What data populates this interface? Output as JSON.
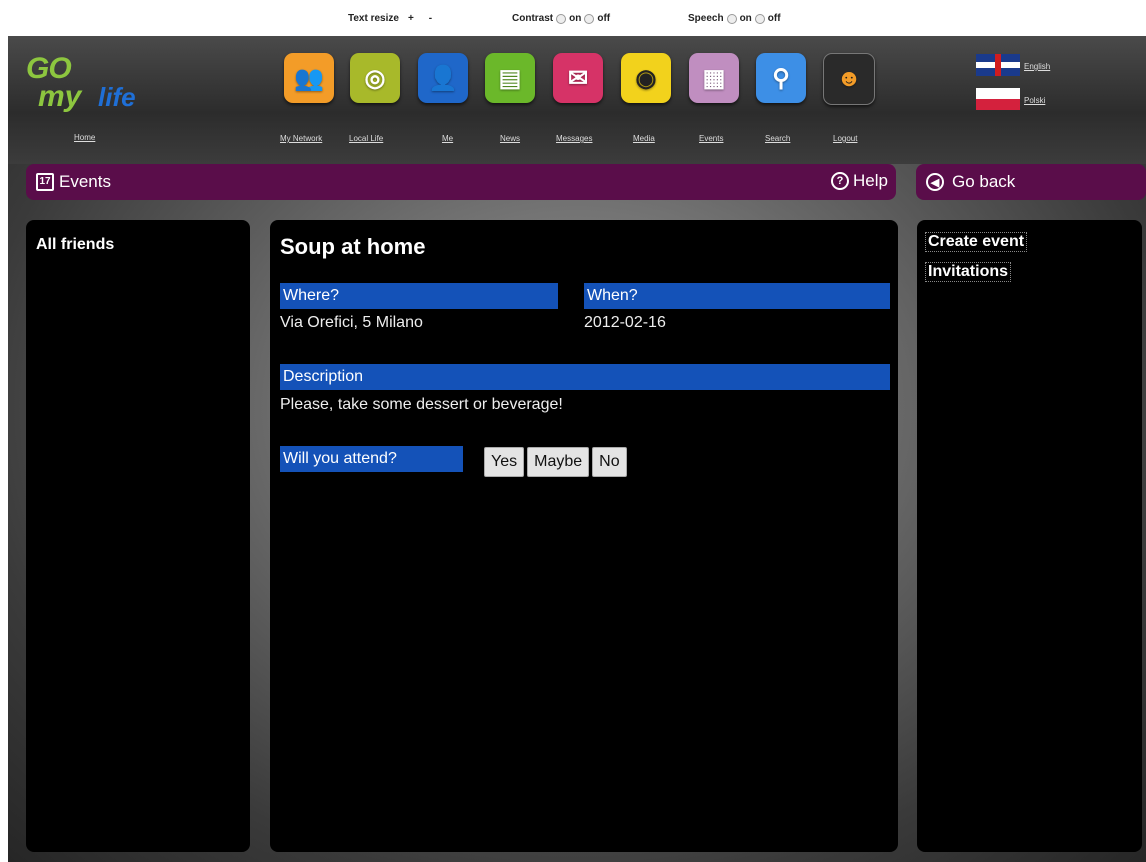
{
  "accessibility": {
    "text_resize_label": "Text resize",
    "text_increase": "+",
    "text_decrease": "-",
    "contrast_label": "Contrast",
    "speech_label": "Speech",
    "on": "on",
    "off": "off"
  },
  "header": {
    "logo_go": "GO",
    "logo_my": "my",
    "logo_life": "life",
    "home_label": "Home",
    "nav": [
      {
        "label": "My Network",
        "icon": "people-icon",
        "color": "#f39c28"
      },
      {
        "label": "Local Life",
        "icon": "target-icon",
        "color": "#a8b92a"
      },
      {
        "label": "Me",
        "icon": "person-icon",
        "color": "#1f67c9"
      },
      {
        "label": "News",
        "icon": "document-icon",
        "color": "#6bb82a"
      },
      {
        "label": "Messages",
        "icon": "envelope-icon",
        "color": "#d63367"
      },
      {
        "label": "Media",
        "icon": "camera-icon",
        "color": "#f2d21c"
      },
      {
        "label": "Events",
        "icon": "calendar-icon",
        "color": "#c08ec0"
      },
      {
        "label": "Search",
        "icon": "magnifier-icon",
        "color": "#3d8fe6"
      },
      {
        "label": "Logout",
        "icon": "user-logout-icon",
        "color": "#2a2a2a"
      }
    ],
    "languages": [
      "English",
      "Polski"
    ]
  },
  "events_bar": {
    "title": "Events",
    "calendar_num": "17",
    "help_label": "Help",
    "help_icon": "?"
  },
  "back_bar": {
    "label": "Go back"
  },
  "left_panel": {
    "title": "All friends"
  },
  "event": {
    "title": "Soup at home",
    "where_label": "Where?",
    "where_value": "Via Orefici, 5 Milano",
    "when_label": "When?",
    "when_value": "2012-02-16",
    "description_label": "Description",
    "description_value": "Please, take some dessert or beverage!",
    "attend_label": "Will you attend?",
    "buttons": [
      "Yes",
      "Maybe",
      "No"
    ]
  },
  "right_panel": {
    "create_event": "Create event",
    "invitations": "Invitations"
  }
}
